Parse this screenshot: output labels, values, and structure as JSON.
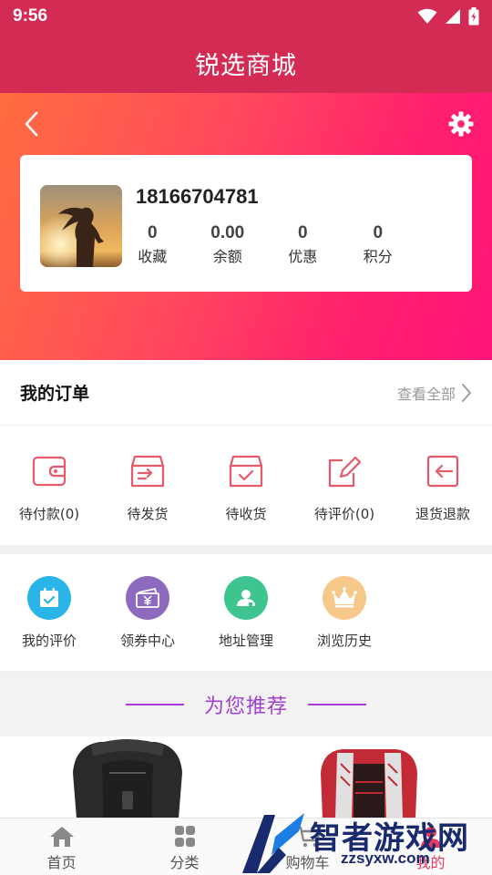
{
  "status_bar": {
    "time": "9:56",
    "icons": [
      "wifi-icon",
      "signal-icon",
      "battery-icon"
    ]
  },
  "header": {
    "title": "锐选商城"
  },
  "profile": {
    "phone": "18166704781",
    "stats": [
      {
        "value": "0",
        "label": "收藏"
      },
      {
        "value": "0.00",
        "label": "余额"
      },
      {
        "value": "0",
        "label": "优惠"
      },
      {
        "value": "0",
        "label": "积分"
      }
    ]
  },
  "orders": {
    "title": "我的订单",
    "view_all": "查看全部",
    "items": [
      {
        "label": "待付款(0)",
        "icon": "wallet-icon"
      },
      {
        "label": "待发货",
        "icon": "package-send-icon"
      },
      {
        "label": "待收货",
        "icon": "box-check-icon"
      },
      {
        "label": "待评价(0)",
        "icon": "edit-icon"
      },
      {
        "label": "退货退款",
        "icon": "return-icon"
      }
    ]
  },
  "services": {
    "items": [
      {
        "label": "我的评价",
        "icon": "calendar-check-icon",
        "color": "#2ab4e8"
      },
      {
        "label": "领券中心",
        "icon": "coupon-icon",
        "color": "#8c6bbf"
      },
      {
        "label": "地址管理",
        "icon": "user-location-icon",
        "color": "#3ec48f"
      },
      {
        "label": "浏览历史",
        "icon": "crown-icon",
        "color": "#f6c98a"
      }
    ]
  },
  "recommend": {
    "title": "为您推荐"
  },
  "tabbar": {
    "items": [
      {
        "label": "首页",
        "icon": "home-icon"
      },
      {
        "label": "分类",
        "icon": "grid-icon"
      },
      {
        "label": "购物车",
        "icon": "cart-icon"
      },
      {
        "label": "我的",
        "icon": "user-icon"
      }
    ]
  },
  "watermark": {
    "text": "智者游戏网",
    "url": "zzsyxw.com"
  },
  "colors": {
    "brand": "#d42b55",
    "accent_icon": "#e55a6a",
    "recommend": "#a040d0"
  }
}
